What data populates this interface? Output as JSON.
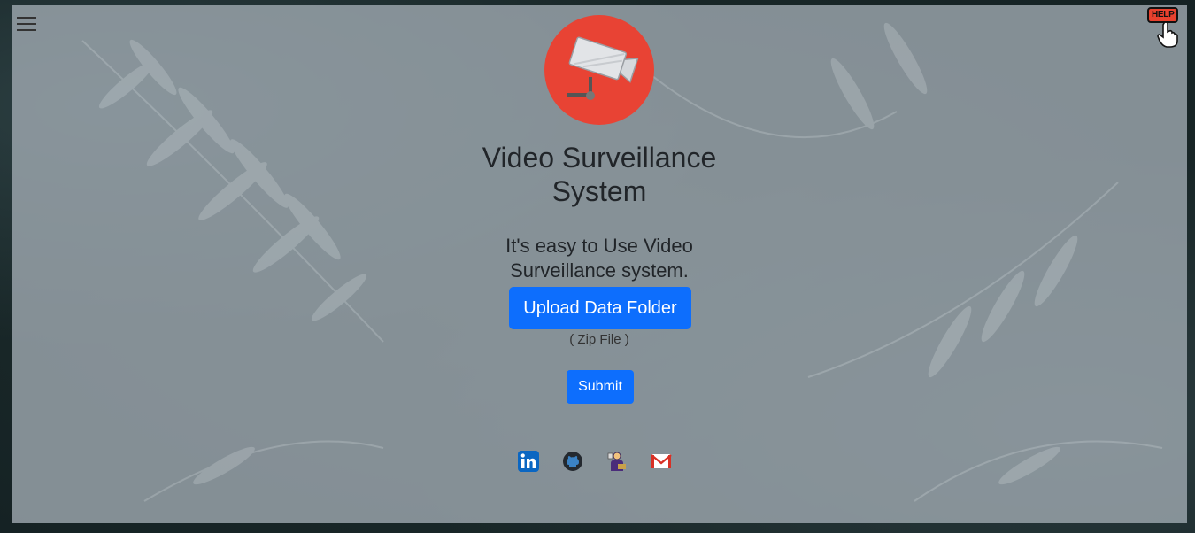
{
  "app": {
    "title": "Video Surveillance System",
    "tagline": "It's easy to Use Video Surveillance system."
  },
  "header": {
    "menu_icon": "hamburger-menu-icon",
    "help_label": "HELP",
    "help_icon": "pointing-hand-icon"
  },
  "logo": {
    "icon": "security-camera-icon",
    "bg_color": "#e84334"
  },
  "upload": {
    "label": "Upload Data Folder",
    "hint": "( Zip File )"
  },
  "submit": {
    "label": "Submit"
  },
  "social": [
    {
      "icon": "linkedin-icon",
      "color": "#0a66c2"
    },
    {
      "icon": "github-icon",
      "color": "#24292f"
    },
    {
      "icon": "portfolio-icon",
      "color": "#4a2c7a"
    },
    {
      "icon": "gmail-icon",
      "color": "#d93025"
    }
  ],
  "colors": {
    "primary": "#0d6efd",
    "help": "#e8412e"
  }
}
